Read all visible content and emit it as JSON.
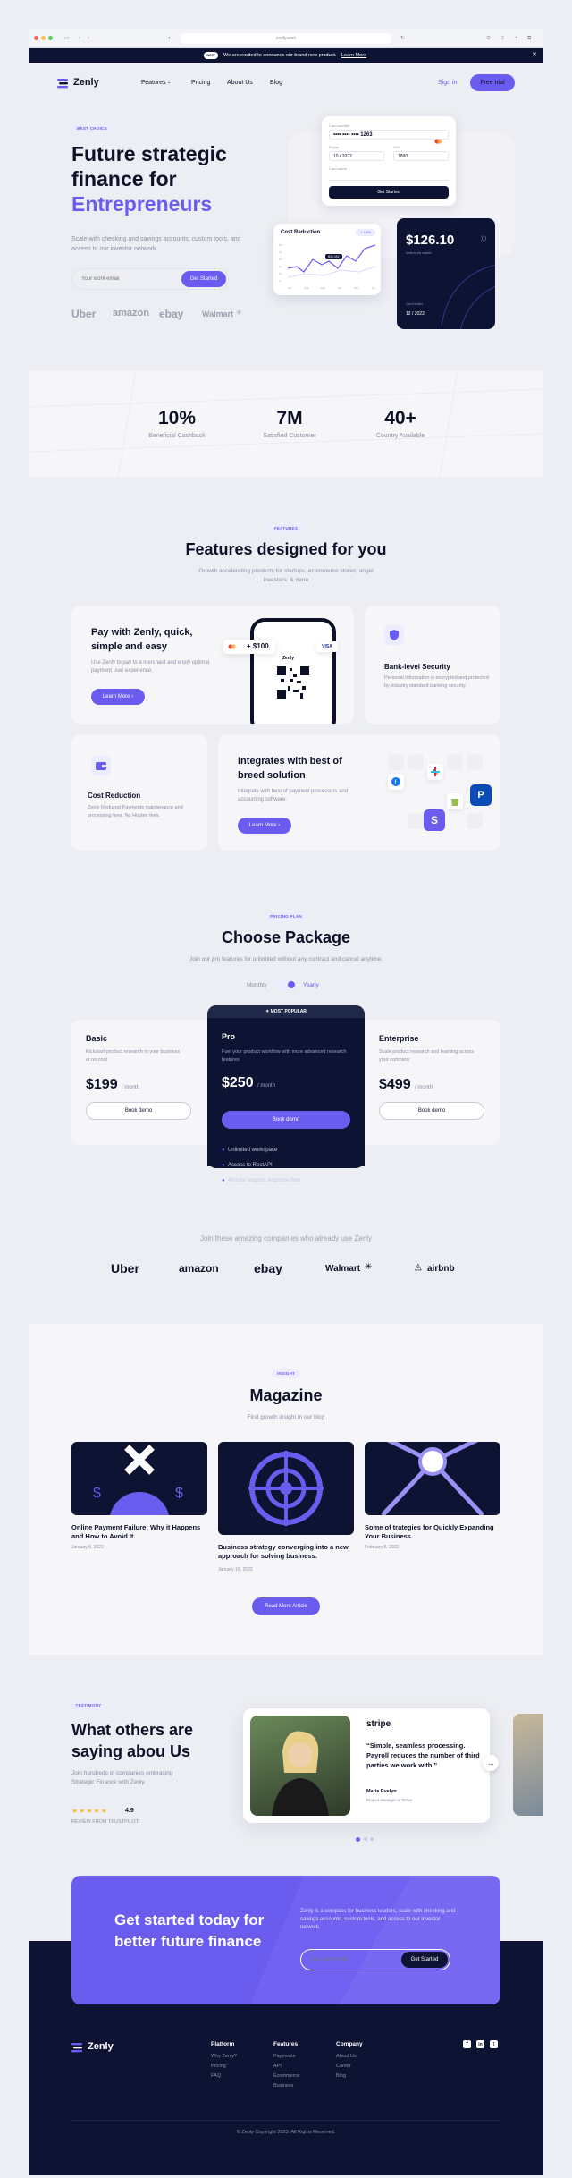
{
  "browser": {
    "url": "zenly.com"
  },
  "announcement": {
    "badge": "NEW",
    "text": "We are excited to announce our brand new product.",
    "link": "Learn More"
  },
  "nav": {
    "brand": "Zenly",
    "links": [
      "Features",
      "Pricing",
      "About Us",
      "Blog"
    ],
    "signin": "Sign in",
    "cta": "Free trial"
  },
  "hero": {
    "tag": "BEST CHOICE",
    "title_line1": "Future strategic",
    "title_line2": "finance for",
    "title_accent": "Entrepreneurs",
    "subtitle": "Scale with checking and savings accounts, custom tools, and access to our investor network.",
    "email_placeholder": "Your work email",
    "cta": "Get Started",
    "logos": [
      "Uber",
      "amazon",
      "ebay",
      "Walmart"
    ]
  },
  "card_widget": {
    "label": "Card number",
    "number": "•••• •••• •••• 1263",
    "exp_label": "Expiry",
    "exp": "10 / 2022",
    "cvv_label": "CVV",
    "cvv": "7890",
    "name_label": "Card name",
    "button": "Get Started"
  },
  "cost_widget": {
    "title": "Cost Reduction",
    "badge": "+ 13%",
    "tooltip": "$36,492",
    "yaxis": [
      "5k",
      "4k",
      "3k",
      "2k",
      "1k",
      "0"
    ],
    "xaxis": [
      "Jan",
      "Feb",
      "Mar",
      "Apr",
      "May",
      "Jun"
    ]
  },
  "balance_widget": {
    "amount": "$126.10",
    "caption": "Match via wallet",
    "name_label": "Card Holder",
    "exp": "12 / 2022"
  },
  "stats": [
    {
      "value": "10%",
      "label": "Beneficial Cashback"
    },
    {
      "value": "7M",
      "label": "Satisfied Customer"
    },
    {
      "value": "40+",
      "label": "Country Available"
    }
  ],
  "features": {
    "tag": "FEATURES",
    "title": "Features designed for you",
    "subtitle": "Growth accelerating products for startups, ecommerce stores, angel investors, & more",
    "pay": {
      "title": "Pay with Zenly, quick, simple and easy",
      "text": "Use Zenly to pay to a merchant and enjoy optimal payment user experience.",
      "cta": "Learn More",
      "amount": "+ $100",
      "phone_brand": "Zenly",
      "visa": "VISA"
    },
    "security": {
      "title": "Bank-level Security",
      "text": "Personal information is encrypted and protected by industry standard banking security."
    },
    "cost": {
      "title": "Cost Reduction",
      "text": "Zenly Reduced Payments maintenance and processing fees. No Hidden fees."
    },
    "integrate": {
      "title": "Integrates with best of breed solution",
      "text": "Integrate with best of payment processors and accounting software.",
      "cta": "Learn More"
    }
  },
  "pricing": {
    "tag": "PRICING PLAN",
    "title": "Choose Package",
    "subtitle": "Join our pro features for unlimited without any contract and cancel anytime.",
    "toggle_monthly": "Monthly",
    "toggle_yearly": "Yearly",
    "plans": [
      {
        "name": "Basic",
        "desc": "Kickstart product research in your business at no cost",
        "price": "$199",
        "period": "/ month",
        "cta": "Book demo"
      },
      {
        "name": "Pro",
        "badge": "✦ MOST POPULAR",
        "desc": "Fuel your product workflow with more advanced research features",
        "price": "$250",
        "period": "/ month",
        "cta": "Book demo",
        "features": [
          "Unlimited workspace",
          "Access to RestAPI",
          "48 hour support response time"
        ]
      },
      {
        "name": "Enterprise",
        "desc": "Scale product research and learning across your company",
        "price": "$499",
        "period": "/ month",
        "cta": "Book demo"
      }
    ]
  },
  "companies": {
    "title": "Join these amazing companies who already use Zenly",
    "logos": [
      "Uber",
      "amazon",
      "ebay",
      "Walmart",
      "airbnb"
    ]
  },
  "magazine": {
    "tag": "INSIGHT",
    "title": "Magazine",
    "subtitle": "Find growth insight in our blog",
    "articles": [
      {
        "title": "Online Payment Failure: Why it Happens and How to Avoid It.",
        "date": "January 8, 2022"
      },
      {
        "title": "Business strategy converging into a new approach for solving business.",
        "date": "January 16, 2022"
      },
      {
        "title": "Some of trategies for Quickly Expanding Your Business.",
        "date": "February 8, 2022"
      }
    ],
    "cta": "Read More Article"
  },
  "testimonial": {
    "tag": "TESTIMONY",
    "title": "What others are saying abou Us",
    "subtitle": "Join hundreds of companies embracing Strategic Finance with Zenly.",
    "rating": "4.9",
    "source": "REVIEW FROM TRUSTPILOT",
    "company": "stripe",
    "quote": "“Simple, seamless processing. Payroll reduces the number of third parties we work with.”",
    "person": "Maria Evelyn",
    "role": "Project Manager at Stripe"
  },
  "cta": {
    "title": "Get started today for better future finance",
    "text": "Zenly is a compass for business leaders, scale with checking and savings accounts, custom tools, and access to our investor network.",
    "placeholder": "Your work email",
    "button": "Get Started"
  },
  "footer": {
    "brand": "Zenly",
    "columns": [
      {
        "title": "Platform",
        "links": [
          "Why Zenly?",
          "Pricing",
          "FAQ"
        ]
      },
      {
        "title": "Features",
        "links": [
          "Payments",
          "API",
          "Ecommerce",
          "Business"
        ]
      },
      {
        "title": "Company",
        "links": [
          "About Us",
          "Career",
          "Blog"
        ]
      }
    ],
    "copyright": "© Zenly Copyright 2023. All Rights Reserved."
  },
  "colors": {
    "accent": "#6b5cf0",
    "navy": "#0d1433",
    "light": "#f6f6f9"
  }
}
